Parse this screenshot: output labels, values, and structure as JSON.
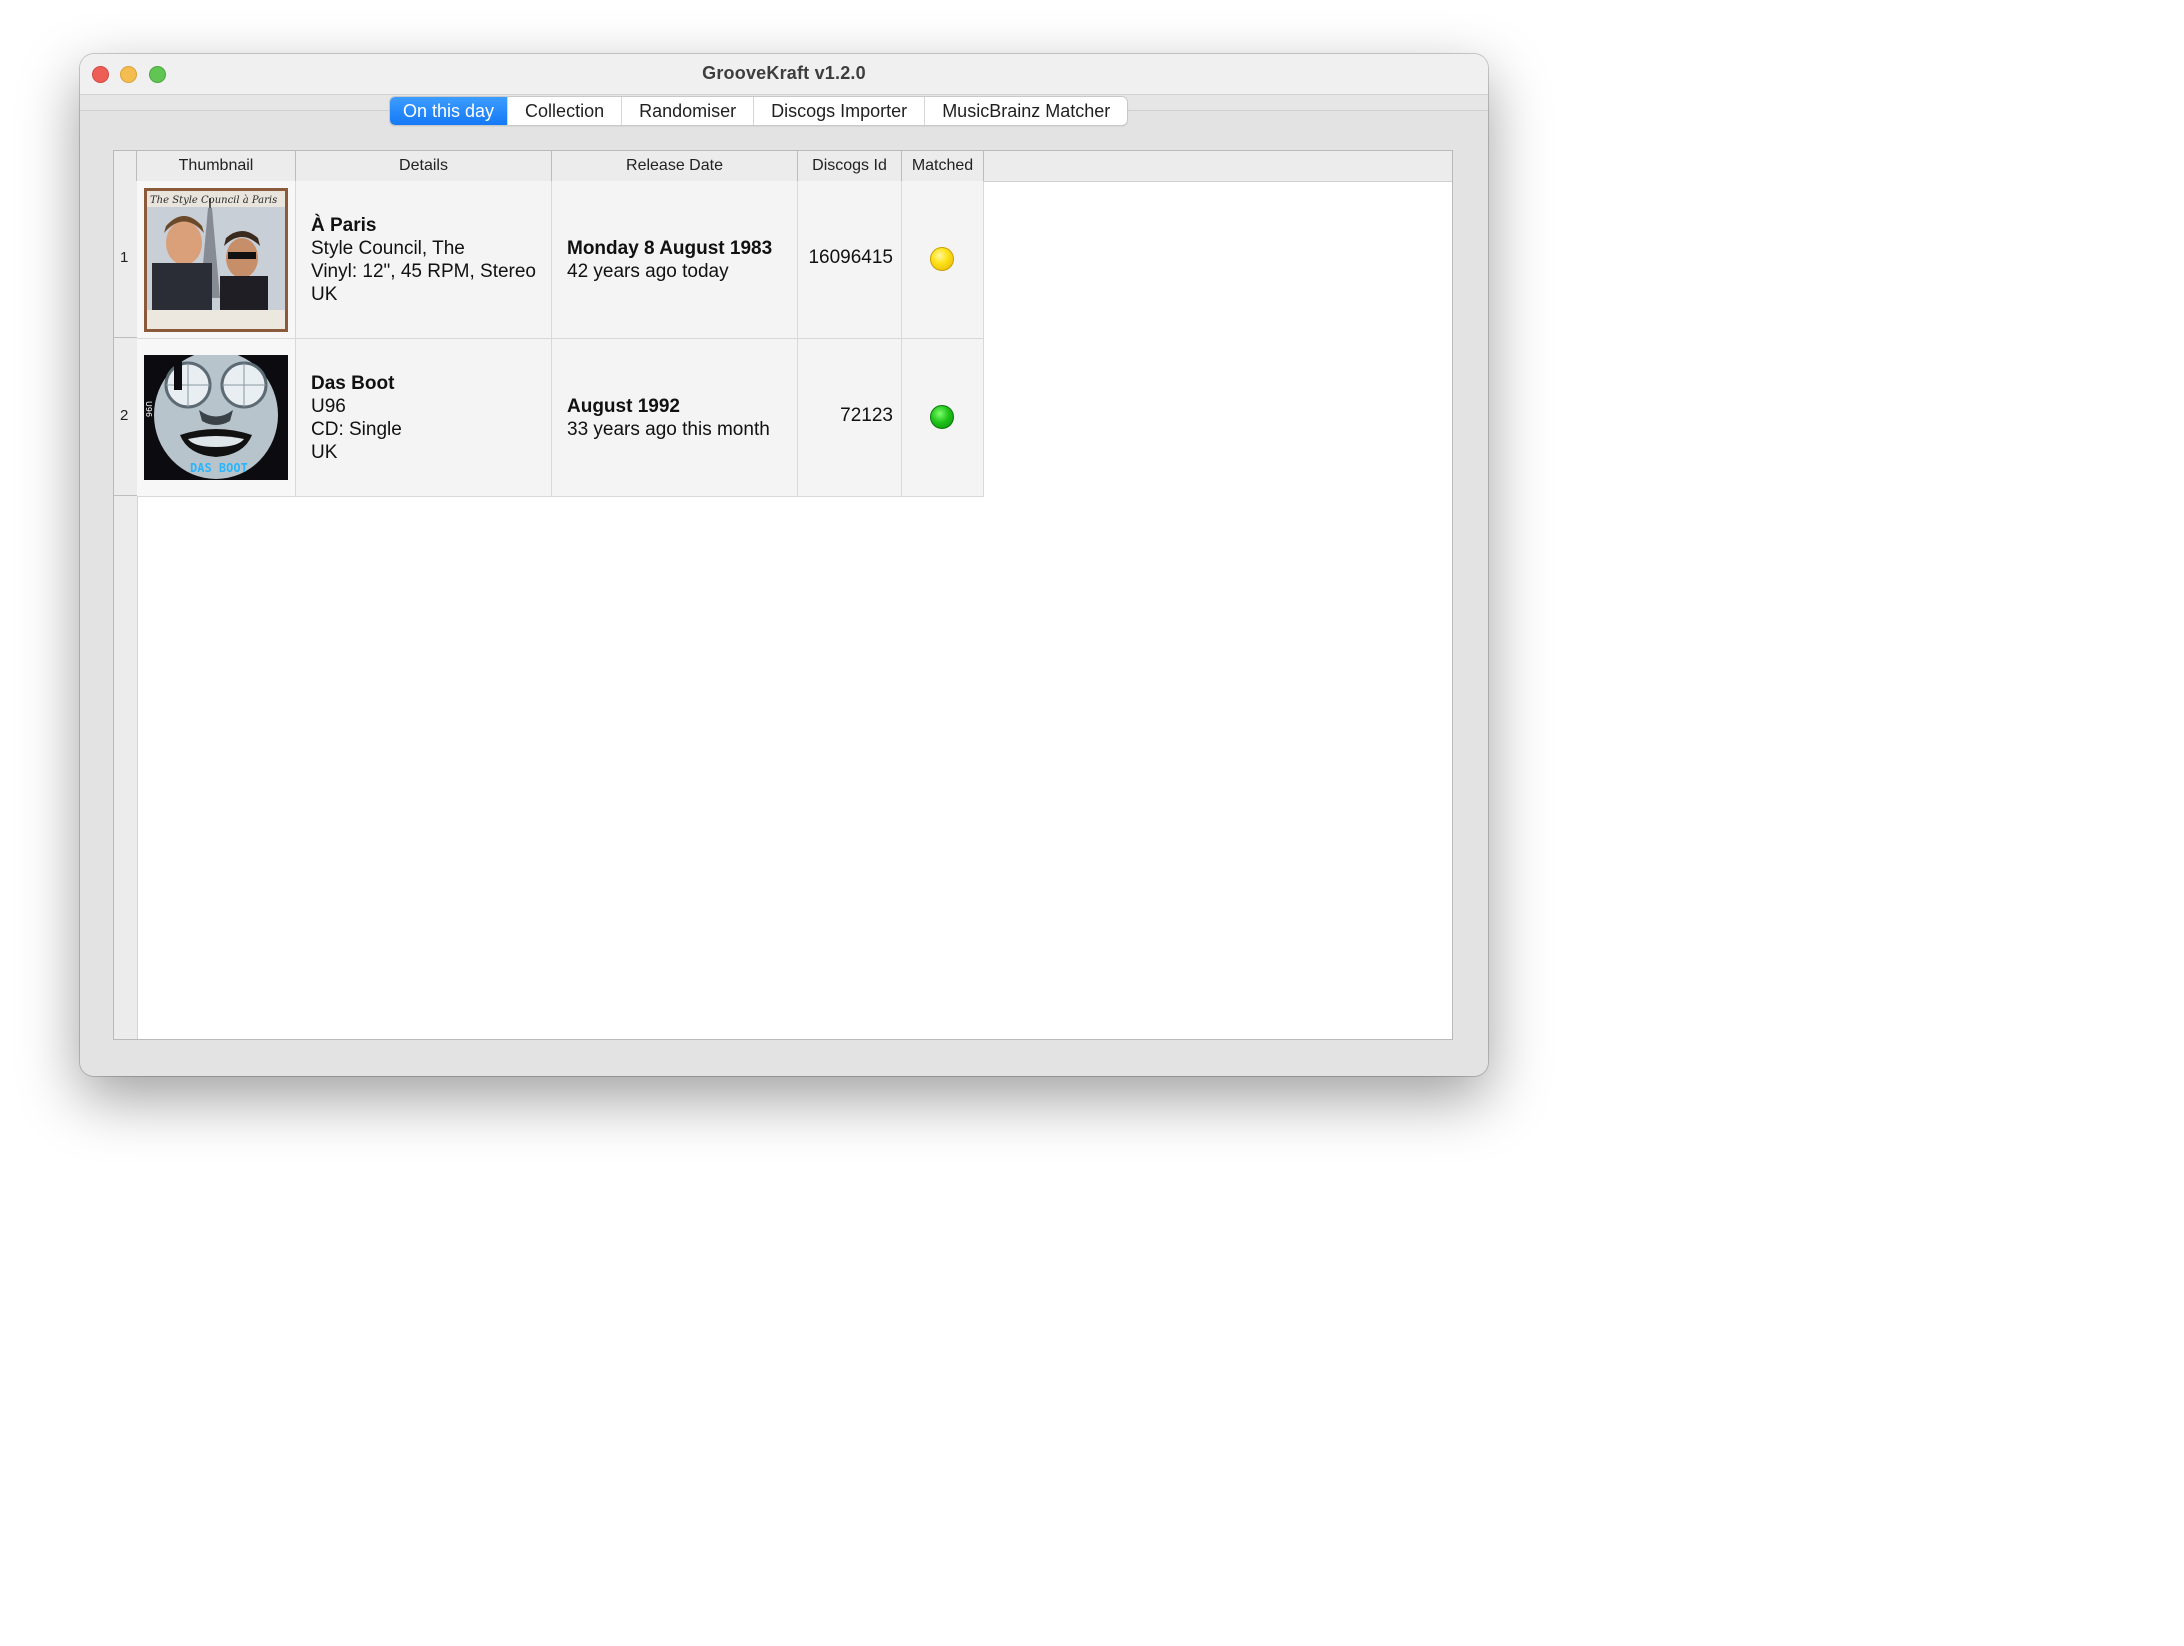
{
  "window": {
    "title": "GrooveKraft v1.2.0"
  },
  "tabs": [
    {
      "label": "On this day",
      "active": true
    },
    {
      "label": "Collection",
      "active": false
    },
    {
      "label": "Randomiser",
      "active": false
    },
    {
      "label": "Discogs Importer",
      "active": false
    },
    {
      "label": "MusicBrainz Matcher",
      "active": false
    }
  ],
  "table": {
    "columns": [
      "Thumbnail",
      "Details",
      "Release Date",
      "Discogs Id",
      "Matched"
    ],
    "rows": [
      {
        "index": "1",
        "thumbnail": {
          "overlay": "The Style Council  à Paris"
        },
        "details": {
          "title": "À Paris",
          "artist": "Style Council, The",
          "format": "Vinyl: 12\", 45 RPM, Stereo",
          "country": "UK"
        },
        "release_date": {
          "date": "Monday 8 August 1983",
          "ago": "42 years ago today"
        },
        "discogs_id": "16096415",
        "matched": {
          "status": "partial",
          "color": "#ffd60a"
        }
      },
      {
        "index": "2",
        "thumbnail": {
          "overlay": "DAS BOOT",
          "side_text": "U96"
        },
        "details": {
          "title": "Das Boot",
          "artist": "U96",
          "format": "CD: Single",
          "country": "UK"
        },
        "release_date": {
          "date": "August 1992",
          "ago": "33 years ago this month"
        },
        "discogs_id": "72123",
        "matched": {
          "status": "matched",
          "color": "#1fb41a"
        }
      }
    ]
  },
  "colors": {
    "accent": "#1479f6",
    "window_bg": "#e6e6e6",
    "traffic_close": "#ed5e56",
    "traffic_minimize": "#f4bd4f",
    "traffic_zoom": "#61c554"
  }
}
